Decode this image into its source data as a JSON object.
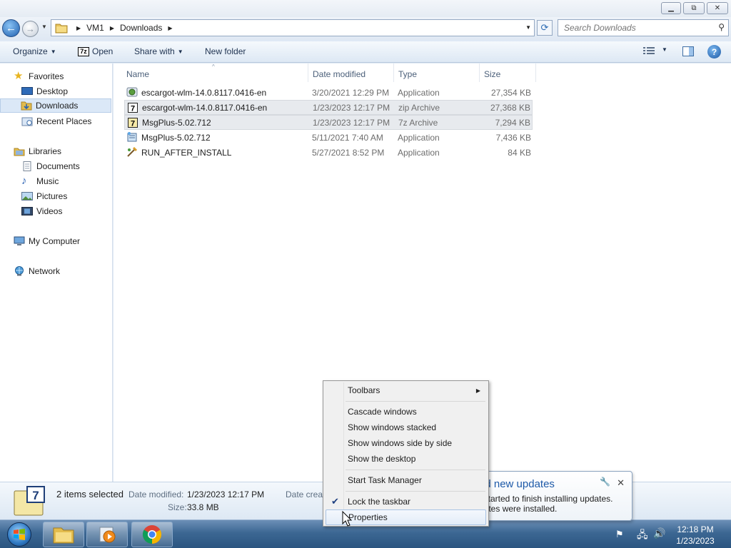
{
  "window": {
    "min_label": "▭",
    "max_label": "⧉",
    "close_label": "✕"
  },
  "address": {
    "crumbs": [
      "VM1",
      "Downloads"
    ],
    "search_placeholder": "Search Downloads"
  },
  "toolbar": {
    "organize": "Organize",
    "open": "Open",
    "open_badge": "7z",
    "share_with": "Share with",
    "new_folder": "New folder",
    "help": "?"
  },
  "nav": {
    "favorites": "Favorites",
    "desktop": "Desktop",
    "downloads": "Downloads",
    "recent_places": "Recent Places",
    "libraries": "Libraries",
    "documents": "Documents",
    "music": "Music",
    "pictures": "Pictures",
    "videos": "Videos",
    "my_computer": "My Computer",
    "network": "Network"
  },
  "columns": {
    "name": "Name",
    "date_modified": "Date modified",
    "type": "Type",
    "size": "Size"
  },
  "files": [
    {
      "name": "escargot-wlm-14.0.8117.0416-en",
      "date": "3/20/2021 12:29 PM",
      "type": "Application",
      "size": "27,354 KB",
      "icon": "installer-icon",
      "selected": false
    },
    {
      "name": "escargot-wlm-14.0.8117.0416-en",
      "date": "1/23/2023 12:17 PM",
      "type": "zip Archive",
      "size": "27,368 KB",
      "icon": "archive-7z-icon",
      "selected": true
    },
    {
      "name": "MsgPlus-5.02.712",
      "date": "1/23/2023 12:17 PM",
      "type": "7z Archive",
      "size": "7,294 KB",
      "icon": "archive-7z-icon",
      "selected": true
    },
    {
      "name": "MsgPlus-5.02.712",
      "date": "5/11/2021 7:40 AM",
      "type": "Application",
      "size": "7,436 KB",
      "icon": "setup-icon",
      "selected": false
    },
    {
      "name": "RUN_AFTER_INSTALL",
      "date": "5/27/2021 8:52 PM",
      "type": "Application",
      "size": "84 KB",
      "icon": "script-icon",
      "selected": false
    }
  ],
  "details": {
    "badge": "7",
    "selection": "2 items selected",
    "date_modified_label": "Date modified:",
    "date_modified_value": "1/23/2023 12:17 PM",
    "date_created_label": "Date creat",
    "size_label": "Size:",
    "size_value": "33.8 MB"
  },
  "balloon": {
    "title": "ed new updates",
    "line1": "estarted to finish installing updates.",
    "line2": "dates were installed."
  },
  "context_menu": {
    "items": [
      {
        "label": "Toolbars",
        "submenu": true
      },
      {
        "label": "Cascade windows"
      },
      {
        "label": "Show windows stacked"
      },
      {
        "label": "Show windows side by side"
      },
      {
        "label": "Show the desktop"
      },
      {
        "label": "Start Task Manager"
      },
      {
        "label": "Lock the taskbar",
        "checked": true
      },
      {
        "label": "Properties",
        "highlighted": true
      }
    ]
  },
  "taskbar": {
    "time": "12:18 PM",
    "date": "1/23/2023"
  },
  "colors": {
    "accent": "#1e5aa8",
    "selection": "#dbe8f7",
    "taskbar": "#3c6793"
  }
}
